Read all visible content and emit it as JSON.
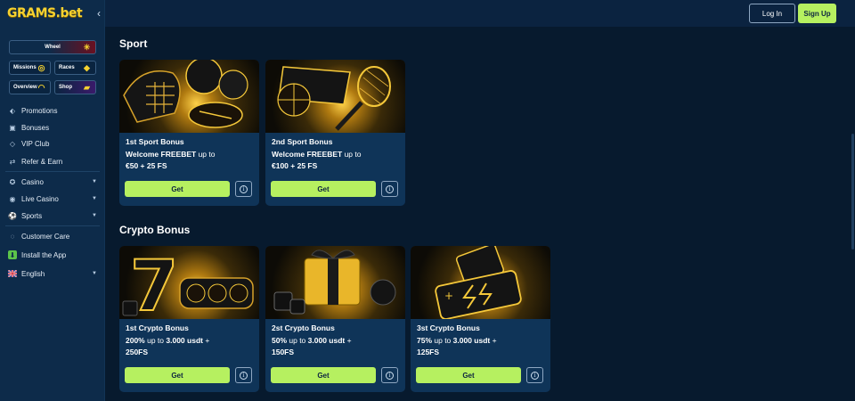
{
  "brand": {
    "logo_text": "GRAMS.bet"
  },
  "header": {
    "login_label": "Log In",
    "signup_label": "Sign Up"
  },
  "sidebar": {
    "tiles": [
      {
        "label": "Wheel"
      },
      {
        "label": "Missions"
      },
      {
        "label": "Races"
      },
      {
        "label": "Overview"
      },
      {
        "label": "Shop"
      }
    ],
    "items": [
      {
        "label": "Promotions",
        "icon": "tag-icon"
      },
      {
        "label": "Bonuses",
        "icon": "gift-icon"
      },
      {
        "label": "VIP Club",
        "icon": "diamond-icon"
      },
      {
        "label": "Refer & Earn",
        "icon": "share-icon"
      },
      {
        "label": "Casino",
        "icon": "casino-chip-icon"
      },
      {
        "label": "Live Casino",
        "icon": "live-icon"
      },
      {
        "label": "Sports",
        "icon": "ball-icon"
      },
      {
        "label": "Customer Care",
        "icon": "chat-icon"
      },
      {
        "label": "Install the App",
        "icon": "download-icon"
      },
      {
        "label": "English",
        "icon": "uk-flag-icon"
      }
    ]
  },
  "sections": [
    {
      "title": "Sport",
      "cards": [
        {
          "title": "1st Sport Bonus",
          "desc_bold": "Welcome FREEBET",
          "desc_normal": " up to",
          "desc_line2": "€50 + 25 FS",
          "cta": "Get"
        },
        {
          "title": "2nd Sport Bonus",
          "desc_bold": "Welcome FREEBET",
          "desc_normal": " up to",
          "desc_line2": "€100 + 25 FS",
          "cta": "Get"
        }
      ]
    },
    {
      "title": "Crypto Bonus",
      "cards": [
        {
          "title": "1st Crypto Bonus",
          "desc_pct": "200%",
          "desc_mid": " up to ",
          "desc_amt": "3.000 usdt",
          "desc_tail": " +",
          "desc_line2": "250FS",
          "cta": "Get"
        },
        {
          "title": "2st Crypto Bonus",
          "desc_pct": "50%",
          "desc_mid": " up to ",
          "desc_amt": "3.000 usdt",
          "desc_tail": " +",
          "desc_line2": "150FS",
          "cta": "Get"
        },
        {
          "title": "3st Crypto Bonus",
          "desc_pct": "75%",
          "desc_mid": " up to ",
          "desc_amt": "3.000 usdt",
          "desc_tail": " +",
          "desc_line2": "125FS",
          "cta": "Get"
        }
      ]
    }
  ],
  "colors": {
    "accent": "#b6f060",
    "sidebar": "#0d2b4a",
    "background": "#071a2e",
    "card": "#0f3458",
    "logo": "#f5d130"
  }
}
